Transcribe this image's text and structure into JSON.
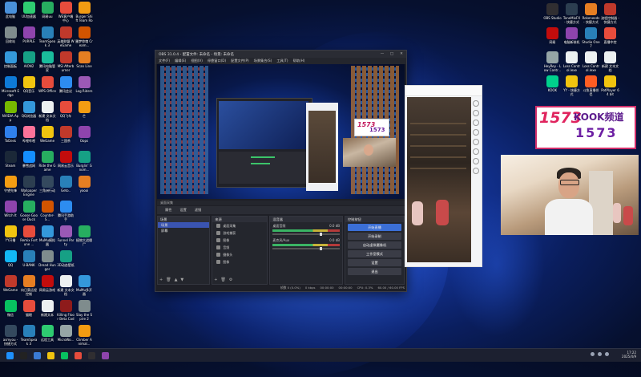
{
  "desktop_left": [
    {
      "label": "此电脑",
      "color": "#4a90d9"
    },
    {
      "label": "UU加速器",
      "color": "#2ecc71"
    },
    {
      "label": "网易uu",
      "color": "#27ae60"
    },
    {
      "label": "WE客户端中心",
      "color": "#e74c3c"
    },
    {
      "label": "Burger Shift Team Roo...",
      "color": "#f39c12"
    },
    {
      "label": "回收站",
      "color": "#7f8c8d"
    },
    {
      "label": "PURPLE",
      "color": "#8e44ad"
    },
    {
      "label": "TeamSpeak 3",
      "color": "#2980b9"
    },
    {
      "label": "英雄联盟 WeGame",
      "color": "#c0392b"
    },
    {
      "label": "噩梦惊魂 Cream...",
      "color": "#d35400"
    },
    {
      "label": "控制面板",
      "color": "#3498db"
    },
    {
      "label": "AION2",
      "color": "#16a085"
    },
    {
      "label": "腾讯电脑管家",
      "color": "#1abc9c"
    },
    {
      "label": "MSI Afterburner",
      "color": "#c0392b"
    },
    {
      "label": "Scan Line",
      "color": "#e67e22"
    },
    {
      "label": "Microsoft Edge",
      "color": "#0e7ad8"
    },
    {
      "label": "QQ音乐",
      "color": "#f1c40f"
    },
    {
      "label": "WPS Office",
      "color": "#e74c3c"
    },
    {
      "label": "腾讯会议",
      "color": "#2d8cf0"
    },
    {
      "label": "Log Riders",
      "color": "#9b59b6"
    },
    {
      "label": "NVIDIA App",
      "color": "#76b900"
    },
    {
      "label": "QQ浏览器",
      "color": "#3498db"
    },
    {
      "label": "新建 文本文档",
      "color": "#ecf0f1"
    },
    {
      "label": "QQ飞车",
      "color": "#e74c3c"
    },
    {
      "label": "芒",
      "color": "#f39c12"
    },
    {
      "label": "ToDesk",
      "color": "#2f80ed"
    },
    {
      "label": "哔哩哔哩",
      "color": "#fb7299"
    },
    {
      "label": "WeGame",
      "color": "#f1c40f"
    },
    {
      "label": "三国杀",
      "color": "#c0392b"
    },
    {
      "label": "Oops",
      "color": "#8e44ad"
    },
    {
      "label": "Steam",
      "color": "#1b2838"
    },
    {
      "label": "暴雪战网",
      "color": "#148eff"
    },
    {
      "label": "Ride the Game",
      "color": "#27ae60"
    },
    {
      "label": "网易云音乐",
      "color": "#c20c0c"
    },
    {
      "label": "Burglin' Gnom...",
      "color": "#16a085"
    },
    {
      "label": "守望先锋",
      "color": "#f39c12"
    },
    {
      "label": "Wallpaper Engine",
      "color": "#2c3e50"
    },
    {
      "label": "三角洲行动",
      "color": "#34495e"
    },
    {
      "label": "Geto..",
      "color": "#2980b9"
    },
    {
      "label": "yoooi",
      "color": "#e67e22"
    },
    {
      "label": "Witch It",
      "color": "#8e44ad"
    },
    {
      "label": "Goose Goose Duck",
      "color": "#27ae60"
    },
    {
      "label": "Counter-S...",
      "color": "#d35400"
    },
    {
      "label": "腾讯手游助手",
      "color": "#2d8cf0"
    },
    {
      "label": "",
      "color": "#000000"
    },
    {
      "label": "YY开播",
      "color": "#f1c40f"
    },
    {
      "label": "Remix Fortune ...",
      "color": "#e74c3c"
    },
    {
      "label": "MuMu模拟器",
      "color": "#3498db"
    },
    {
      "label": "Funnel Party",
      "color": "#9b59b6"
    },
    {
      "label": "植物大战僵尸",
      "color": "#27ae60"
    },
    {
      "label": "QQ",
      "color": "#12b7f5"
    },
    {
      "label": "U-BANK",
      "color": "#2980b9"
    },
    {
      "label": "Dread Hunger",
      "color": "#7f8c8d"
    },
    {
      "label": "3D动态壁纸",
      "color": "#16a085"
    },
    {
      "label": "",
      "color": "#000000"
    },
    {
      "label": "WeGame",
      "color": "#c0392b"
    },
    {
      "label": "向日葵远程控制",
      "color": "#e67e22"
    },
    {
      "label": "网易云游戏",
      "color": "#c20c0c"
    },
    {
      "label": "新建 文本文档",
      "color": "#ecf0f1"
    },
    {
      "label": "MuMu多开器",
      "color": "#3498db"
    },
    {
      "label": "微信",
      "color": "#07c160"
    },
    {
      "label": "猫眼",
      "color": "#e74c3c"
    },
    {
      "label": "新建文本",
      "color": "#ecf0f1"
    },
    {
      "label": "Killing Floor Beta Codi...",
      "color": "#8e1b1b"
    },
    {
      "label": "Slay the Spire 2",
      "color": "#7f8c8d"
    },
    {
      "label": "asmyou - 快捷方式",
      "color": "#34495e"
    },
    {
      "label": "TeamSpeak 3",
      "color": "#2980b9"
    },
    {
      "label": "远程工具",
      "color": "#2ecc71"
    },
    {
      "label": "MicroWo...",
      "color": "#95a5a6"
    },
    {
      "label": "Climber Animal...",
      "color": "#f39c12"
    }
  ],
  "desktop_right": [
    {
      "label": "OBS Studio",
      "color": "#302e31"
    },
    {
      "label": "ToneMixFX - 快捷方式",
      "color": "#2c3e50"
    },
    {
      "label": "Rekeneeds - 快捷方式",
      "color": "#e67e22"
    },
    {
      "label": "流程控制器 - 快捷方式",
      "color": "#c0392b"
    },
    {
      "label": "网易",
      "color": "#c20c0c"
    },
    {
      "label": "电脑新装机",
      "color": "#8e44ad"
    },
    {
      "label": "Studio One 7",
      "color": "#2980b9"
    },
    {
      "label": "直播中控",
      "color": "#e74c3c"
    },
    {
      "label": "HeyRey - Low Contr...",
      "color": "#95a5a6"
    },
    {
      "label": "Loss Control.lexe",
      "color": "#ecf0f1"
    },
    {
      "label": "Loss Control.lexe",
      "color": "#ecf0f1"
    },
    {
      "label": "新建 文本文档",
      "color": "#ecf0f1"
    },
    {
      "label": "KOOK",
      "color": "#00d18c"
    },
    {
      "label": "YY - 快捷方式",
      "color": "#f1c40f"
    },
    {
      "label": "斗鱼直播伴侣",
      "color": "#ff5d23"
    },
    {
      "label": "PotPlayer 64 bit",
      "color": "#f1c40f"
    }
  ],
  "obs": {
    "title": "OBS 31.0.4 - 配置文件: 未命名 - 场景: 未命名",
    "window_controls": [
      "—",
      "□",
      "✕"
    ],
    "menu": [
      "文件(F)",
      "编辑(E)",
      "视图(V)",
      "停靠窗口(D)",
      "配置文件(P)",
      "场景集合(S)",
      "工具(T)",
      "帮助(H)"
    ],
    "source_name": "桌面采集",
    "toolbar": [
      "属性",
      "设置",
      "滤镜"
    ],
    "scenes_header": "场景",
    "scenes": [
      "场景",
      "屏幕"
    ],
    "sources_header": "来源",
    "sources": [
      "桌面采集",
      "游戏捕获",
      "图像",
      "音频",
      "摄像头",
      "图像"
    ],
    "mixer_header": "混音器",
    "mixer": [
      {
        "label": "桌面音频",
        "db": "0.0 dB"
      },
      {
        "label": "麦克风/Aux",
        "db": "0.0 dB"
      }
    ],
    "controls_header": "控制按钮",
    "controls": [
      "开始直播",
      "开始录制",
      "启动虚拟摄像机",
      "工作室模式",
      "设置",
      "退出"
    ],
    "dock_footer_icons": [
      "+",
      "🗑",
      "⚙",
      "▲",
      "▼"
    ],
    "status": [
      "帧数 0 (0.0%)",
      "0 kbps",
      "00:00:00",
      "00:00:00",
      "CPU: 0.3%",
      "60.00 / 60.00 FPS"
    ]
  },
  "kook": {
    "num": "1573",
    "brand": "KOOK频道",
    "sub": "1573"
  },
  "taskbar": {
    "icons": [
      "#1e90ff",
      "#222",
      "#3a7bd5",
      "#f1c40f",
      "#07c160",
      "#e74c3c",
      "#302e31",
      "#8e44ad"
    ],
    "time": "17:22",
    "date": "2025/4/9"
  }
}
